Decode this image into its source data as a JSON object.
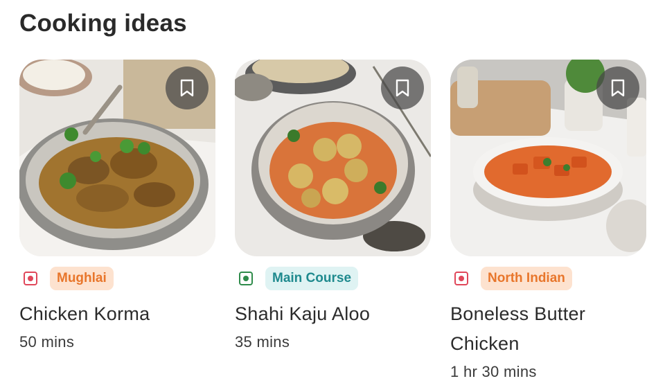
{
  "section_title": "Cooking ideas",
  "colors": {
    "nonveg": "#e0475a",
    "veg": "#2e8b4a",
    "mughlai_bg": "#fde2cf",
    "mughlai_text": "#e8762b",
    "maincourse_bg": "#dff3f3",
    "maincourse_text": "#1f8a8e",
    "northindian_bg": "#fde2cf",
    "northindian_text": "#e8762b"
  },
  "recipes": [
    {
      "name": "Chicken Korma",
      "time": "50 mins",
      "tag": "Mughlai",
      "diet": "non-veg",
      "image": "chicken-korma-photo",
      "bookmark_icon": "bookmark-icon"
    },
    {
      "name": "Shahi Kaju Aloo",
      "time": "35 mins",
      "tag": "Main Course",
      "diet": "veg",
      "image": "shahi-kaju-aloo-photo",
      "bookmark_icon": "bookmark-icon"
    },
    {
      "name": "Boneless Butter Chicken",
      "time": "1 hr 30 mins",
      "tag": "North Indian",
      "diet": "non-veg",
      "image": "butter-chicken-photo",
      "bookmark_icon": "bookmark-icon"
    }
  ]
}
